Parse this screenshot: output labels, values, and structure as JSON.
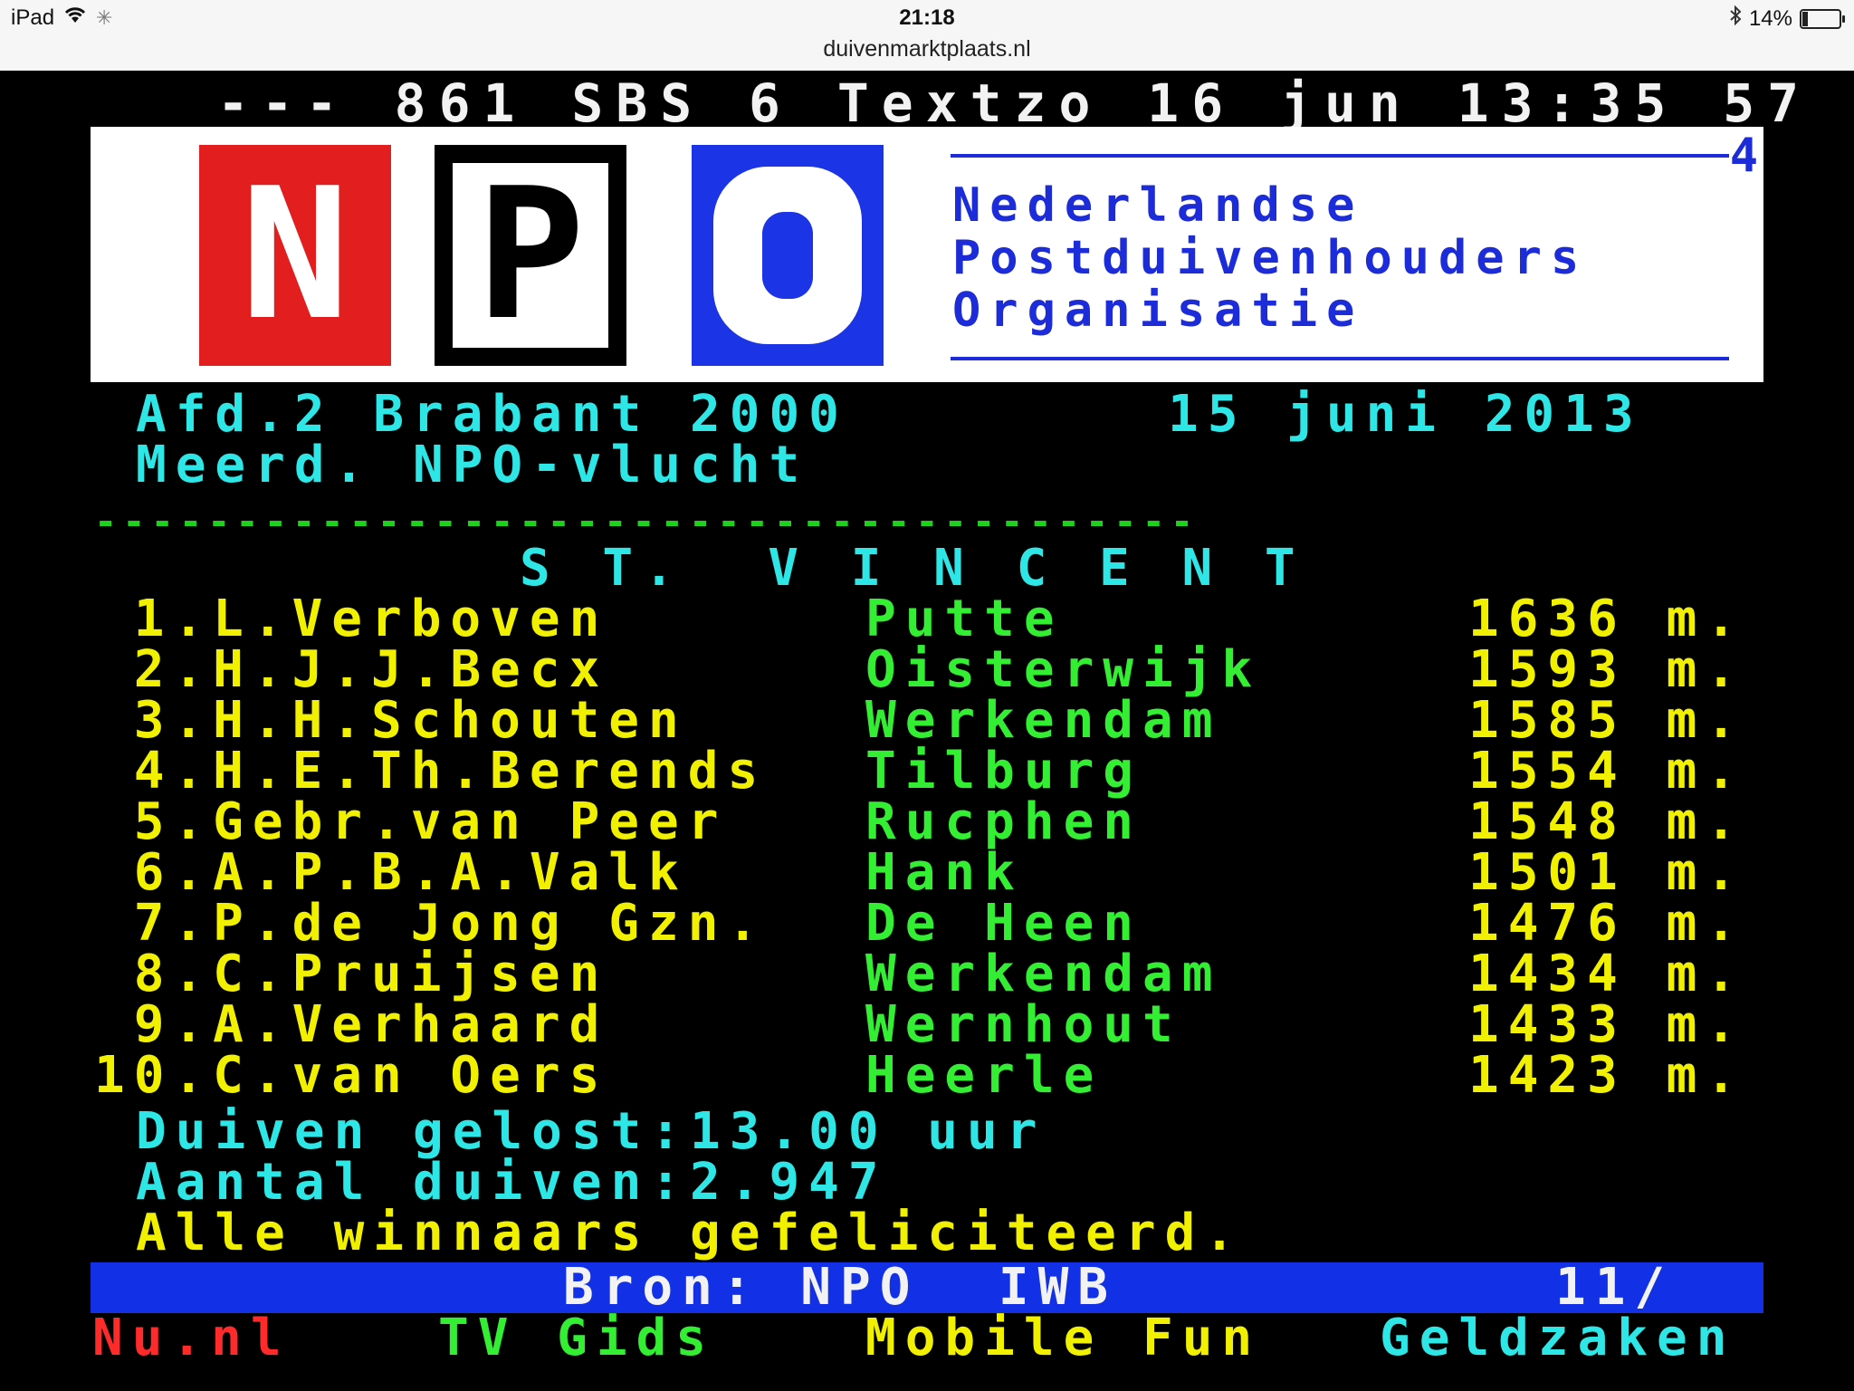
{
  "status_bar": {
    "device": "iPad",
    "time": "21:18",
    "url": "duivenmarktplaats.nl",
    "battery": "14%",
    "battery_level": 0.14
  },
  "teletext": {
    "header": "--- 861 SBS 6 Textzo 16 jun 13:35 57",
    "banner": {
      "page_marker": "4",
      "logo_letters": [
        "N",
        "P",
        "O"
      ],
      "lines": [
        "Nederlandse",
        "Postduivenhouders",
        "Organisatie"
      ]
    },
    "race": {
      "title_left": "Afd.2 Brabant 2000",
      "date": "15 juni 2013",
      "subtitle": "Meerd. NPO-vlucht",
      "separator": "---------------------------------------",
      "location": "S T.  V I N C E N T"
    },
    "results": [
      {
        "name": " 1.L.Verboven",
        "town": "Putte",
        "distance": "1636 m."
      },
      {
        "name": " 2.H.J.J.Becx",
        "town": "Oisterwijk",
        "distance": "1593 m."
      },
      {
        "name": " 3.H.H.Schouten",
        "town": "Werkendam",
        "distance": "1585 m."
      },
      {
        "name": " 4.H.E.Th.Berends",
        "town": "Tilburg",
        "distance": "1554 m."
      },
      {
        "name": " 5.Gebr.van Peer",
        "town": "Rucphen",
        "distance": "1548 m."
      },
      {
        "name": " 6.A.P.B.A.Valk",
        "town": "Hank",
        "distance": "1501 m."
      },
      {
        "name": " 7.P.de Jong Gzn.",
        "town": "De Heen",
        "distance": "1476 m."
      },
      {
        "name": " 8.C.Pruijsen",
        "town": "Werkendam",
        "distance": "1434 m."
      },
      {
        "name": " 9.A.Verhaard",
        "town": "Wernhout",
        "distance": "1433 m."
      },
      {
        "name": "10.C.van Oers",
        "town": "Heerle",
        "distance": "1423 m."
      }
    ],
    "info": [
      "Duiven gelost:13.00 uur",
      "Aantal duiven:2.947",
      "Alle winnaars gefeliciteerd."
    ],
    "source_bar": {
      "text": "Bron: NPO  IWB",
      "page": "11/"
    },
    "fastext": [
      {
        "label": "Nu.nl",
        "color": "#ff2a2a"
      },
      {
        "label": "TV Gids",
        "color": "#33ee33"
      },
      {
        "label": "Mobile Fun",
        "color": "#f0f000"
      },
      {
        "label": "Geldzaken",
        "color": "#2ee6e6"
      }
    ]
  }
}
